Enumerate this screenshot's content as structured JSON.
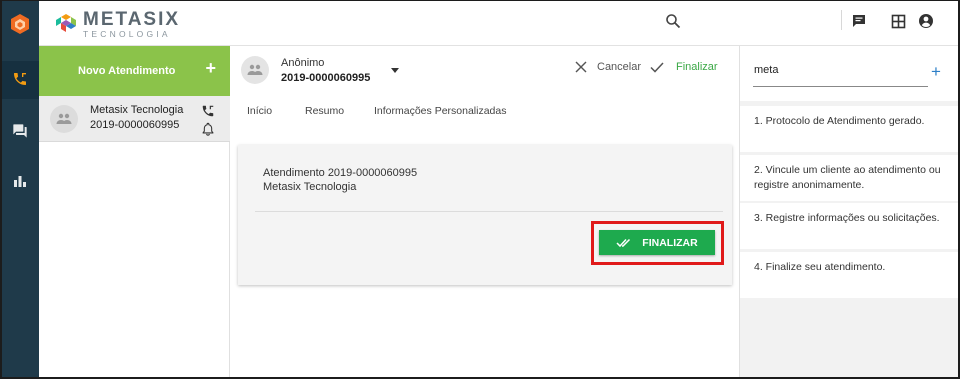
{
  "brand": {
    "name": "METASIX",
    "sub": "TECNOLOGIA"
  },
  "colors": {
    "rail": "#1f3a4a",
    "accent_green": "#8bc34a",
    "button_green": "#1eaa4e",
    "highlight_red": "#e01a1a",
    "link_blue": "#2d7fc7"
  },
  "nav": {
    "icons": [
      "logo-icon",
      "phone-icon",
      "chat-icon",
      "bar-chart-icon"
    ]
  },
  "topbar": {
    "icons": [
      "search-icon",
      "message-icon",
      "grid-icon",
      "account-icon"
    ]
  },
  "list": {
    "new_label": "Novo Atendimento",
    "new_plus": "+",
    "items": [
      {
        "name": "Metasix Tecnologia",
        "protocol": "2019-0000060995"
      }
    ]
  },
  "main": {
    "contact_name": "Anônimo",
    "protocol": "2019-0000060995",
    "cancel_label": "Cancelar",
    "finalize_label": "Finalizar",
    "tabs": [
      "Início",
      "Resumo",
      "Informações Personalizadas"
    ],
    "card": {
      "line1": "Atendimento 2019-0000060995",
      "line2": "Metasix Tecnologia",
      "button_label": "FINALIZAR"
    }
  },
  "right": {
    "search_value": "meta",
    "plus": "+",
    "steps": [
      "1. Protocolo de Atendimento gerado.",
      "2. Vincule um cliente ao atendimento ou registre anonimamente.",
      "3. Registre informações ou solicitações.",
      "4. Finalize seu atendimento."
    ]
  }
}
